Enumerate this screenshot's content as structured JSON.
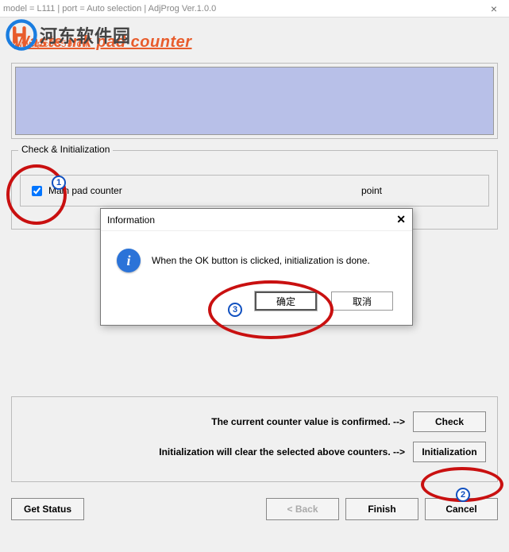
{
  "titlebar": {
    "text": "model = L111 | port = Auto selection | AdjProg Ver.1.0.0"
  },
  "watermark": {
    "text": "河东软件园",
    "url": "www.pc0359.cn"
  },
  "page": {
    "title": "Waste ink pad counter"
  },
  "fieldset": {
    "legend": "Check & Initialization",
    "checkbox_label": "Main pad counter",
    "point_label": "point"
  },
  "dialog": {
    "title": "Information",
    "message": "When the OK button is clicked, initialization is done.",
    "ok": "确定",
    "cancel": "取消"
  },
  "actions": {
    "check_text": "The current counter value is confirmed. -->",
    "check_btn": "Check",
    "init_text": "Initialization will clear the selected above counters. -->",
    "init_btn": "Initialization"
  },
  "bottom": {
    "get_status": "Get Status",
    "back": "< Back",
    "finish": "Finish",
    "cancel": "Cancel"
  },
  "annotations": {
    "n1": "1",
    "n2": "2",
    "n3": "3"
  }
}
